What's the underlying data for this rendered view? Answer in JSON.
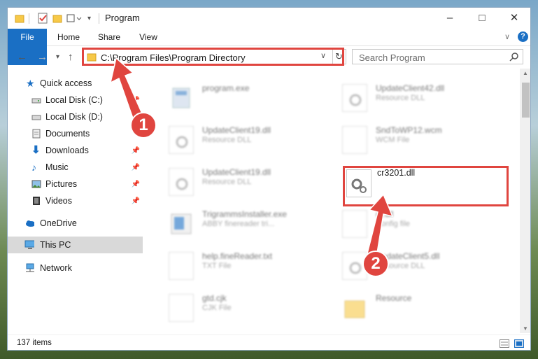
{
  "window": {
    "title": "Program"
  },
  "title_controls": {
    "minimize": "–",
    "maximize": "□",
    "close": "✕"
  },
  "ribbon": {
    "tabs": [
      "File",
      "Home",
      "Share",
      "View"
    ],
    "expand_icon": "chevron-down-icon",
    "help_icon": "?"
  },
  "address_bar": {
    "path": "C:\\Program Files\\Program Directory",
    "search_placeholder": "Search Program"
  },
  "nav_buttons": {
    "back": "←",
    "forward": "→",
    "recent": "▾",
    "up": "↑"
  },
  "sidebar": {
    "items": [
      {
        "label": "Quick access",
        "icon": "star-icon"
      },
      {
        "label": "Local Disk (C:)",
        "icon": "drive-icon"
      },
      {
        "label": "Local Disk (D:)",
        "icon": "drive-icon"
      },
      {
        "label": "Documents",
        "icon": "documents-icon"
      },
      {
        "label": "Downloads",
        "icon": "download-icon"
      },
      {
        "label": "Music",
        "icon": "music-icon"
      },
      {
        "label": "Pictures",
        "icon": "pictures-icon"
      },
      {
        "label": "Videos",
        "icon": "videos-icon"
      },
      {
        "label": "OneDrive",
        "icon": "cloud-icon"
      },
      {
        "label": "This PC",
        "icon": "computer-icon"
      },
      {
        "label": "Network",
        "icon": "network-icon"
      }
    ]
  },
  "files": [
    {
      "name": "program.exe",
      "type": ""
    },
    {
      "name": "UpdateClient42.dll",
      "type": "Resource DLL"
    },
    {
      "name": "UpdateClient19.dll",
      "type": "Resource DLL"
    },
    {
      "name": "SndToWP12.wcm",
      "type": "WCM File"
    },
    {
      "name": "UpdateClient19.dll",
      "type": "Resource DLL"
    },
    {
      "name": "cr3201.dll",
      "type": ""
    },
    {
      "name": "TrigrammsInstaller.exe",
      "type": "ABBY finereader tri..."
    },
    {
      "name": "qt.dll",
      "type": "Config file"
    },
    {
      "name": "help.fineReader.txt",
      "type": "TXT File"
    },
    {
      "name": "UpdateClient5.dll",
      "type": "Resource DLL"
    },
    {
      "name": "gtd.cjk",
      "type": "CJK File"
    },
    {
      "name": "Resource",
      "type": ""
    }
  ],
  "status": {
    "count": "137 items"
  },
  "callouts": {
    "one": "1",
    "two": "2"
  },
  "colors": {
    "accent": "#1a6fc4",
    "highlight": "#e0453f"
  }
}
